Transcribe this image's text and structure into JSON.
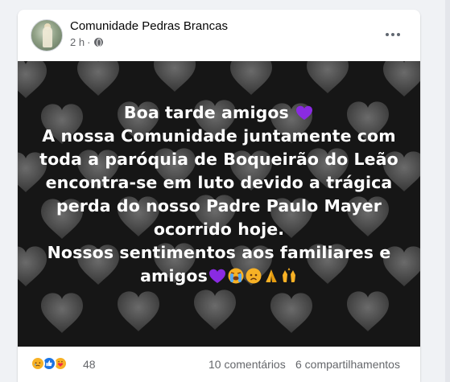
{
  "post": {
    "page_name": "Comunidade Pedras Brancas",
    "time": "2 h",
    "dot": "·",
    "text_lines": [
      "Boa tarde amigos",
      "A nossa Comunidade juntamente com",
      "toda a paróquia de Boqueirão do Leão",
      "encontra-se em luto devido a trágica",
      "perda do nosso Padre Paulo Mayer",
      "ocorrido hoje.",
      "Nossos sentimentos aos familiares e",
      "amigos"
    ],
    "emojis": {
      "line1": [
        "purple-heart"
      ],
      "line8": [
        "purple-heart",
        "loudly-crying-face",
        "sad-face",
        "folded-hands",
        "raising-hands"
      ]
    }
  },
  "footer": {
    "reactions": [
      "sad",
      "like",
      "care"
    ],
    "reaction_count": "48",
    "comments": "10 comentários",
    "shares": "6 compartilhamentos"
  },
  "colors": {
    "image_bg": "#161616",
    "heart_gray": "#6f6f6f",
    "purple_heart": "#8a2be2",
    "like_blue": "#1b74e4",
    "emoji_yellow": "#f7b125"
  }
}
